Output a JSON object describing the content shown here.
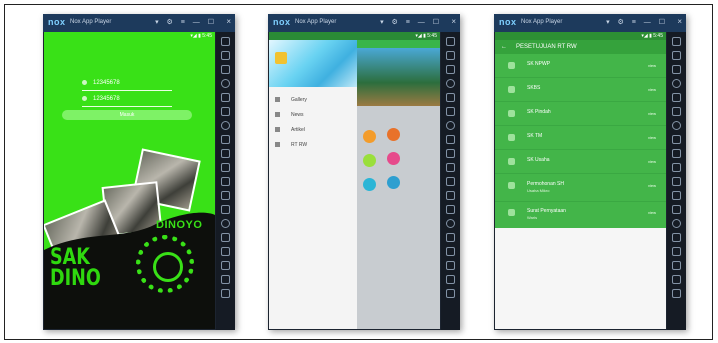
{
  "emulator": {
    "logo": "nox",
    "title": "Nox App Player",
    "controls": "▾ ⚙ ≡ — ☐",
    "close": "×",
    "status": "▾◢ ▮ 5:45"
  },
  "screen1": {
    "username": "12345678",
    "password": "12345678",
    "login_label": "Masuk",
    "brand_line1": "SAK",
    "brand_line2": "DINO",
    "emblem_text": "DINOYO"
  },
  "screen2": {
    "drawer_items": [
      {
        "icon": "gallery-icon",
        "label": "Gallery"
      },
      {
        "icon": "news-icon",
        "label": "News"
      },
      {
        "icon": "info-icon",
        "label": "Artikel"
      },
      {
        "icon": "tool-icon",
        "label": "RT RW"
      }
    ]
  },
  "screen3": {
    "header": "PESETUJUAN RT RW",
    "items": [
      {
        "title": "SK NPWP",
        "sub": "",
        "meta": "view"
      },
      {
        "title": "SKBS",
        "sub": "",
        "meta": "view"
      },
      {
        "title": "SK Pindah",
        "sub": "",
        "meta": "view"
      },
      {
        "title": "SK TM",
        "sub": "",
        "meta": "view"
      },
      {
        "title": "SK Usaha",
        "sub": "",
        "meta": "view"
      },
      {
        "title": "Permohonan SH",
        "sub": "Usaha Mikro",
        "meta": "view"
      },
      {
        "title": "Surat Pernyataan",
        "sub": "Waris",
        "meta": "view"
      }
    ]
  },
  "colors": {
    "nox_titlebar": "#1d3a5c",
    "app_green": "#39e117",
    "list_green": "#43b549"
  }
}
